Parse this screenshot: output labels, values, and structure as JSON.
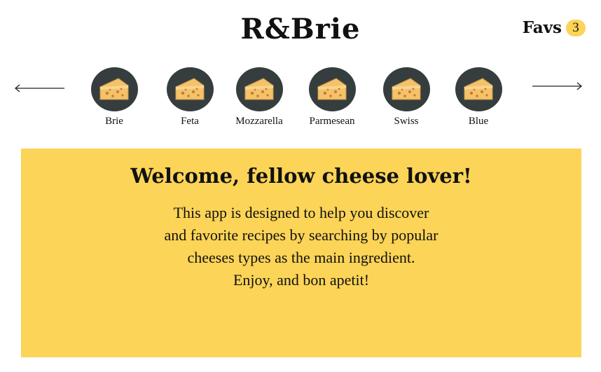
{
  "header": {
    "logo": "R&Brie",
    "favs_label": "Favs",
    "favs_count": "3"
  },
  "carousel": {
    "prev_icon": "arrow-left-icon",
    "next_icon": "arrow-right-icon",
    "items": [
      {
        "label": "Brie",
        "icon": "cheese-icon"
      },
      {
        "label": "Feta",
        "icon": "cheese-icon"
      },
      {
        "label": "Mozzarella",
        "icon": "cheese-icon"
      },
      {
        "label": "Parmesean",
        "icon": "cheese-icon"
      },
      {
        "label": "Swiss",
        "icon": "cheese-icon"
      },
      {
        "label": "Blue",
        "icon": "cheese-icon"
      }
    ]
  },
  "welcome": {
    "title": "Welcome, fellow cheese lover!",
    "lines": [
      "This app is designed to help you discover",
      "and favorite recipes by searching by popular",
      "cheeses types as the main ingredient.",
      "Enjoy, and bon apetit!"
    ]
  },
  "colors": {
    "accent": "#fcd457",
    "circle": "#363d3f",
    "cheese": "#f3c26b",
    "text": "#111111"
  }
}
